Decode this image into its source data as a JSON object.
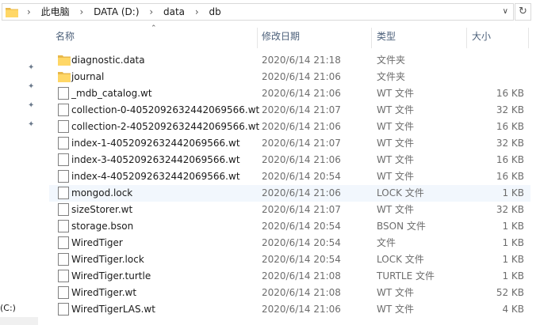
{
  "address": {
    "crumbs": [
      "此电脑",
      "DATA (D:)",
      "data",
      "db"
    ]
  },
  "columns": {
    "name": "名称",
    "date": "修改日期",
    "type": "类型",
    "size": "大小"
  },
  "left_pane": {
    "drive_label": "(C:)"
  },
  "files": [
    {
      "name": "diagnostic.data",
      "date": "2020/6/14 21:18",
      "type": "文件夹",
      "size": "",
      "kind": "folder"
    },
    {
      "name": "journal",
      "date": "2020/6/14 21:06",
      "type": "文件夹",
      "size": "",
      "kind": "folder"
    },
    {
      "name": "_mdb_catalog.wt",
      "date": "2020/6/14 21:06",
      "type": "WT 文件",
      "size": "16 KB",
      "kind": "file"
    },
    {
      "name": "collection-0-4052092632442069566.wt",
      "date": "2020/6/14 21:07",
      "type": "WT 文件",
      "size": "32 KB",
      "kind": "file"
    },
    {
      "name": "collection-2-4052092632442069566.wt",
      "date": "2020/6/14 21:06",
      "type": "WT 文件",
      "size": "16 KB",
      "kind": "file"
    },
    {
      "name": "index-1-4052092632442069566.wt",
      "date": "2020/6/14 21:07",
      "type": "WT 文件",
      "size": "32 KB",
      "kind": "file"
    },
    {
      "name": "index-3-4052092632442069566.wt",
      "date": "2020/6/14 21:06",
      "type": "WT 文件",
      "size": "16 KB",
      "kind": "file"
    },
    {
      "name": "index-4-4052092632442069566.wt",
      "date": "2020/6/14 20:54",
      "type": "WT 文件",
      "size": "16 KB",
      "kind": "file"
    },
    {
      "name": "mongod.lock",
      "date": "2020/6/14 21:06",
      "type": "LOCK 文件",
      "size": "1 KB",
      "kind": "file",
      "selected": true
    },
    {
      "name": "sizeStorer.wt",
      "date": "2020/6/14 21:07",
      "type": "WT 文件",
      "size": "32 KB",
      "kind": "file"
    },
    {
      "name": "storage.bson",
      "date": "2020/6/14 20:54",
      "type": "BSON 文件",
      "size": "1 KB",
      "kind": "file"
    },
    {
      "name": "WiredTiger",
      "date": "2020/6/14 20:54",
      "type": "文件",
      "size": "1 KB",
      "kind": "file"
    },
    {
      "name": "WiredTiger.lock",
      "date": "2020/6/14 20:54",
      "type": "LOCK 文件",
      "size": "1 KB",
      "kind": "file"
    },
    {
      "name": "WiredTiger.turtle",
      "date": "2020/6/14 21:08",
      "type": "TURTLE 文件",
      "size": "1 KB",
      "kind": "file"
    },
    {
      "name": "WiredTiger.wt",
      "date": "2020/6/14 21:08",
      "type": "WT 文件",
      "size": "52 KB",
      "kind": "file"
    },
    {
      "name": "WiredTigerLAS.wt",
      "date": "2020/6/14 21:06",
      "type": "WT 文件",
      "size": "4 KB",
      "kind": "file"
    }
  ],
  "colors": {
    "folder": "#ffd766",
    "folder_dark": "#e8b84a",
    "header_text": "#4c607a",
    "selected_row": "#f2f7fd"
  }
}
